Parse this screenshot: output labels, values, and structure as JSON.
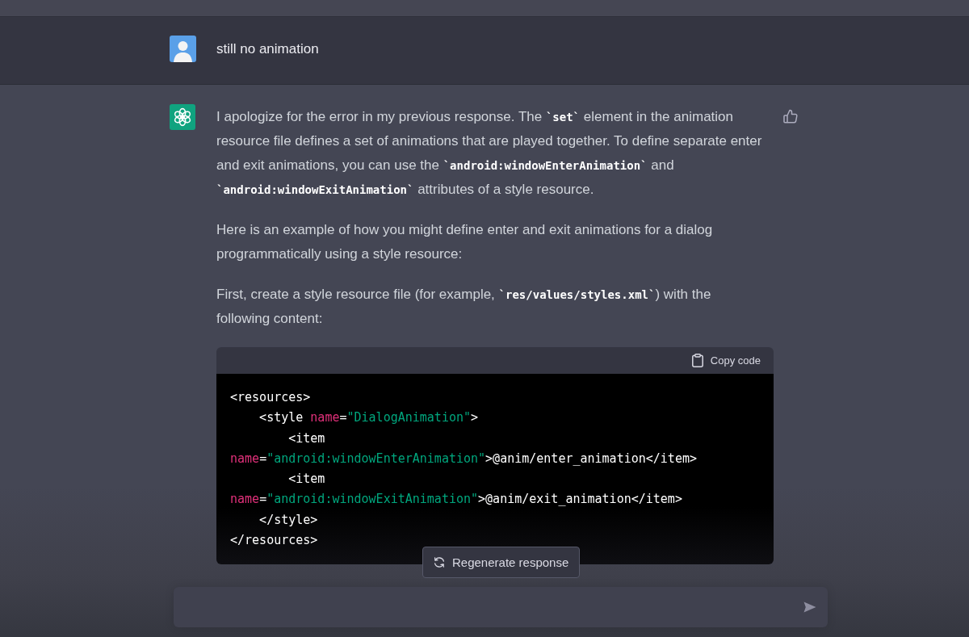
{
  "user_message": {
    "text": "still no animation"
  },
  "assistant_message": {
    "paragraphs": [
      {
        "segments": [
          {
            "kind": "text",
            "text": "I apologize for the error in my previous response. The "
          },
          {
            "kind": "code",
            "text": "`set`"
          },
          {
            "kind": "text",
            "text": " element in the animation resource file defines a set of animations that are played together. To define separate enter and exit animations, you can use the "
          },
          {
            "kind": "code",
            "text": "`android:windowEnterAnimation`"
          },
          {
            "kind": "text",
            "text": " and "
          },
          {
            "kind": "code",
            "text": "`android:windowExitAnimation`"
          },
          {
            "kind": "text",
            "text": " attributes of a style resource."
          }
        ]
      },
      {
        "segments": [
          {
            "kind": "text",
            "text": "Here is an example of how you might define enter and exit animations for a dialog programmatically using a style resource:"
          }
        ]
      },
      {
        "segments": [
          {
            "kind": "text",
            "text": "First, create a style resource file (for example, "
          },
          {
            "kind": "code",
            "text": "`res/values/styles.xml`"
          },
          {
            "kind": "text",
            "text": ") with the following content:"
          }
        ]
      }
    ],
    "code_block": {
      "copy_label": "Copy code",
      "lines": [
        [
          {
            "kind": "plain",
            "text": "<resources>"
          }
        ],
        [
          {
            "kind": "plain",
            "text": "    <style "
          },
          {
            "kind": "attr",
            "text": "name"
          },
          {
            "kind": "plain",
            "text": "="
          },
          {
            "kind": "string",
            "text": "\"DialogAnimation\""
          },
          {
            "kind": "plain",
            "text": ">"
          }
        ],
        [
          {
            "kind": "plain",
            "text": "        <item"
          }
        ],
        [
          {
            "kind": "attr",
            "text": "name"
          },
          {
            "kind": "plain",
            "text": "="
          },
          {
            "kind": "string",
            "text": "\"android:windowEnterAnimation\""
          },
          {
            "kind": "plain",
            "text": ">@anim/enter_animation</item>"
          }
        ],
        [
          {
            "kind": "plain",
            "text": "        <item"
          }
        ],
        [
          {
            "kind": "attr",
            "text": "name"
          },
          {
            "kind": "plain",
            "text": "="
          },
          {
            "kind": "string",
            "text": "\"android:windowExitAnimation\""
          },
          {
            "kind": "plain",
            "text": ">@anim/exit_animation</item>"
          }
        ],
        [
          {
            "kind": "plain",
            "text": "    </style>"
          }
        ],
        [
          {
            "kind": "plain",
            "text": "</resources>"
          }
        ]
      ]
    }
  },
  "regenerate_button": {
    "label": "Regenerate response"
  }
}
